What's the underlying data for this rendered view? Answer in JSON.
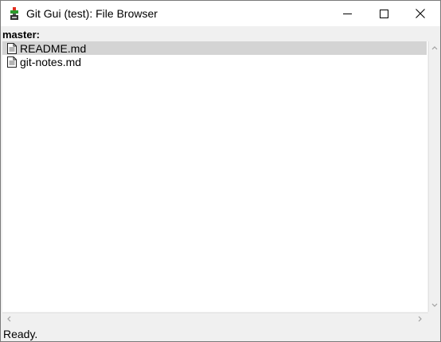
{
  "window": {
    "title": "Git Gui (test): File Browser",
    "icons": {
      "app": "git-gui-icon",
      "minimize": "minimize-icon",
      "maximize": "maximize-icon",
      "close": "close-icon"
    }
  },
  "browser": {
    "branch": "master:",
    "files": [
      {
        "name": "README.md",
        "selected": true,
        "icon": "file-icon"
      },
      {
        "name": "git-notes.md",
        "selected": false,
        "icon": "file-icon"
      }
    ],
    "selection_color": "#d4d4d4"
  },
  "status": {
    "text": "Ready."
  }
}
